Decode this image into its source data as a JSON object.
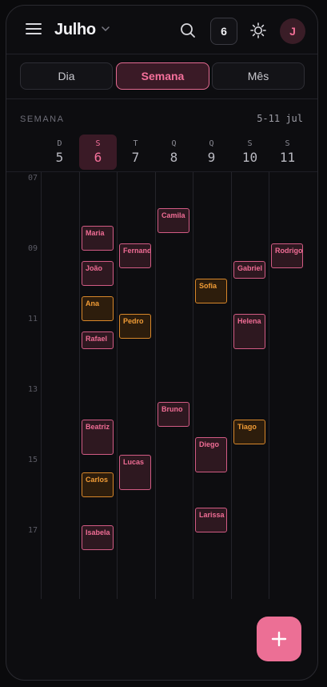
{
  "header": {
    "month": "Julho",
    "today_number": "6",
    "avatar_initial": "J"
  },
  "tabs": [
    "Dia",
    "Semana",
    "Mês"
  ],
  "active_tab": "Semana",
  "week": {
    "label": "SEMANA",
    "range": "5-11 jul",
    "days": [
      {
        "letter": "D",
        "number": "5"
      },
      {
        "letter": "S",
        "number": "6",
        "today": true
      },
      {
        "letter": "T",
        "number": "7"
      },
      {
        "letter": "Q",
        "number": "8"
      },
      {
        "letter": "Q",
        "number": "9"
      },
      {
        "letter": "S",
        "number": "10"
      },
      {
        "letter": "S",
        "number": "11"
      }
    ],
    "hours": [
      "07",
      "09",
      "11",
      "13",
      "15",
      "17"
    ]
  },
  "events": [
    {
      "name": "Camila",
      "day": 3,
      "start": 8.0,
      "end": 8.7,
      "color": "pink"
    },
    {
      "name": "Maria",
      "day": 1,
      "start": 8.5,
      "end": 9.2,
      "color": "pink"
    },
    {
      "name": "Fernanda",
      "day": 2,
      "start": 9.0,
      "end": 9.7,
      "color": "pink"
    },
    {
      "name": "Rodrigo",
      "day": 6,
      "start": 9.0,
      "end": 9.7,
      "color": "pink"
    },
    {
      "name": "João",
      "day": 1,
      "start": 9.5,
      "end": 10.2,
      "color": "pink"
    },
    {
      "name": "Gabriel",
      "day": 5,
      "start": 9.5,
      "end": 10.0,
      "color": "pink"
    },
    {
      "name": "Sofia",
      "day": 4,
      "start": 10.0,
      "end": 10.7,
      "color": "orange"
    },
    {
      "name": "Ana",
      "day": 1,
      "start": 10.5,
      "end": 11.2,
      "color": "orange"
    },
    {
      "name": "Pedro",
      "day": 2,
      "start": 11.0,
      "end": 11.7,
      "color": "orange"
    },
    {
      "name": "Helena",
      "day": 5,
      "start": 11.0,
      "end": 12.0,
      "color": "pink"
    },
    {
      "name": "Rafael",
      "day": 1,
      "start": 11.5,
      "end": 12.0,
      "color": "pink"
    },
    {
      "name": "Bruno",
      "day": 3,
      "start": 13.5,
      "end": 14.2,
      "color": "pink"
    },
    {
      "name": "Beatriz",
      "day": 1,
      "start": 14.0,
      "end": 15.0,
      "color": "pink"
    },
    {
      "name": "Tiago",
      "day": 5,
      "start": 14.0,
      "end": 14.7,
      "color": "orange"
    },
    {
      "name": "Diego",
      "day": 4,
      "start": 14.5,
      "end": 15.5,
      "color": "pink"
    },
    {
      "name": "Lucas",
      "day": 2,
      "start": 15.0,
      "end": 16.0,
      "color": "pink"
    },
    {
      "name": "Carlos",
      "day": 1,
      "start": 15.5,
      "end": 16.2,
      "color": "orange"
    },
    {
      "name": "Larissa",
      "day": 4,
      "start": 16.5,
      "end": 17.2,
      "color": "pink"
    },
    {
      "name": "Isabela",
      "day": 1,
      "start": 17.0,
      "end": 17.7,
      "color": "pink"
    }
  ]
}
